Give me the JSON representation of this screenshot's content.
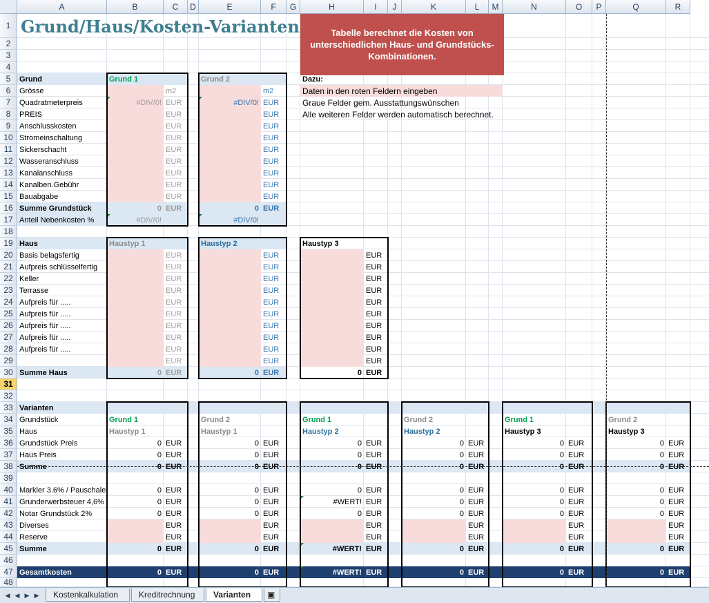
{
  "sheet": {
    "columns": [
      "A",
      "B",
      "C",
      "D",
      "E",
      "F",
      "G",
      "H",
      "I",
      "J",
      "K",
      "L",
      "M",
      "N",
      "O",
      "P",
      "Q",
      "R"
    ],
    "rows": [
      "1",
      "2",
      "3",
      "4",
      "5",
      "6",
      "7",
      "8",
      "9",
      "10",
      "11",
      "12",
      "13",
      "14",
      "15",
      "16",
      "17",
      "18",
      "19",
      "20",
      "21",
      "22",
      "23",
      "24",
      "25",
      "26",
      "27",
      "28",
      "29",
      "30",
      "31",
      "32",
      "33",
      "34",
      "35",
      "36",
      "37",
      "38",
      "39",
      "40",
      "41",
      "42",
      "43",
      "44",
      "45",
      "46",
      "47",
      "48"
    ],
    "selected_row": "31",
    "title": "Grund/Haus/Kosten-Varianten",
    "info_box": "Tabelle berechnet die Kosten von unterschiedlichen Haus- und Grundstücks-Kombinationen.",
    "dazu": {
      "label": "Dazu:",
      "lines": [
        "Daten in den roten Feldern eingeben",
        "Graue Felder gem. Ausstattungswünschen",
        "Alle weiteren Felder werden automatisch berechnet."
      ]
    }
  },
  "grund": {
    "section_label": "Grund",
    "row_labels": [
      "Grösse",
      "Quadratmeterpreis",
      "PREIS",
      "Anschlusskosten",
      "Stromeinschaltung",
      "Sickerschacht",
      "Wasseranschluss",
      "Kanalanschluss",
      "Kanalben.Gebühr",
      "Bauabgabe"
    ],
    "sum_label": "Summe Grundstück",
    "ratio_label": "Anteil Nebenkosten %",
    "col1_header": "Grund 1",
    "col2_header": "Grund 2",
    "unit_m2": "m2",
    "unit_eur": "EUR",
    "div_error": "#DIV/0!",
    "sum_value": "0"
  },
  "haus": {
    "section_label": "Haus",
    "row_labels": [
      "Basis belagsfertig",
      "Aufpreis schlüsselfertig",
      "Keller",
      "Terrasse",
      "Aufpreis für .....",
      "Aufpreis für .....",
      "Aufpreis für .....",
      "Aufpreis für .....",
      "Aufpreis für .....",
      ""
    ],
    "sum_label": "Summe Haus",
    "types": [
      "Haustyp 1",
      "Haustyp 2",
      "Haustyp 3"
    ],
    "unit_eur": "EUR",
    "sum_value": "0"
  },
  "varianten": {
    "section_label": "Varianten",
    "row_labels": {
      "grundstueck": "Grundstück",
      "haus": "Haus",
      "grund_preis": "Grundstück Preis",
      "haus_preis": "Haus Preis",
      "summe": "Summe",
      "makler": "Markler 3.6% / Pauschale",
      "grunderwerb": "Grunderwerbsteuer 4,6%",
      "notar": "Notar Grundstück 2%",
      "diverses": "Diverses",
      "reserve": "Reserve",
      "summe2": "Summe",
      "gesamt": "Gesamtkosten"
    },
    "variants": [
      {
        "grund": "Grund 1",
        "haus": "Haustyp 1"
      },
      {
        "grund": "Grund 2",
        "haus": "Haustyp 1"
      },
      {
        "grund": "Grund 1",
        "haus": "Haustyp 2"
      },
      {
        "grund": "Grund 2",
        "haus": "Haustyp 2"
      },
      {
        "grund": "Grund 1",
        "haus": "Haustyp 3"
      },
      {
        "grund": "Grund 2",
        "haus": "Haustyp 3"
      }
    ],
    "zero": "0",
    "wert_error": "#WERT!",
    "unit_eur": "EUR"
  },
  "tabs": {
    "sheets": [
      "Kostenkalkulation",
      "Kreditrechnung",
      "Varianten"
    ],
    "active": "Varianten"
  },
  "colors": {
    "title": "#3f7f92",
    "info_box": "#c0504d",
    "pink_input": "#f8dcdc",
    "band": "#dbe7f3",
    "total_bar": "#1f3f6e",
    "green_header": "#00a050",
    "blue_header": "#2f6f9e"
  }
}
